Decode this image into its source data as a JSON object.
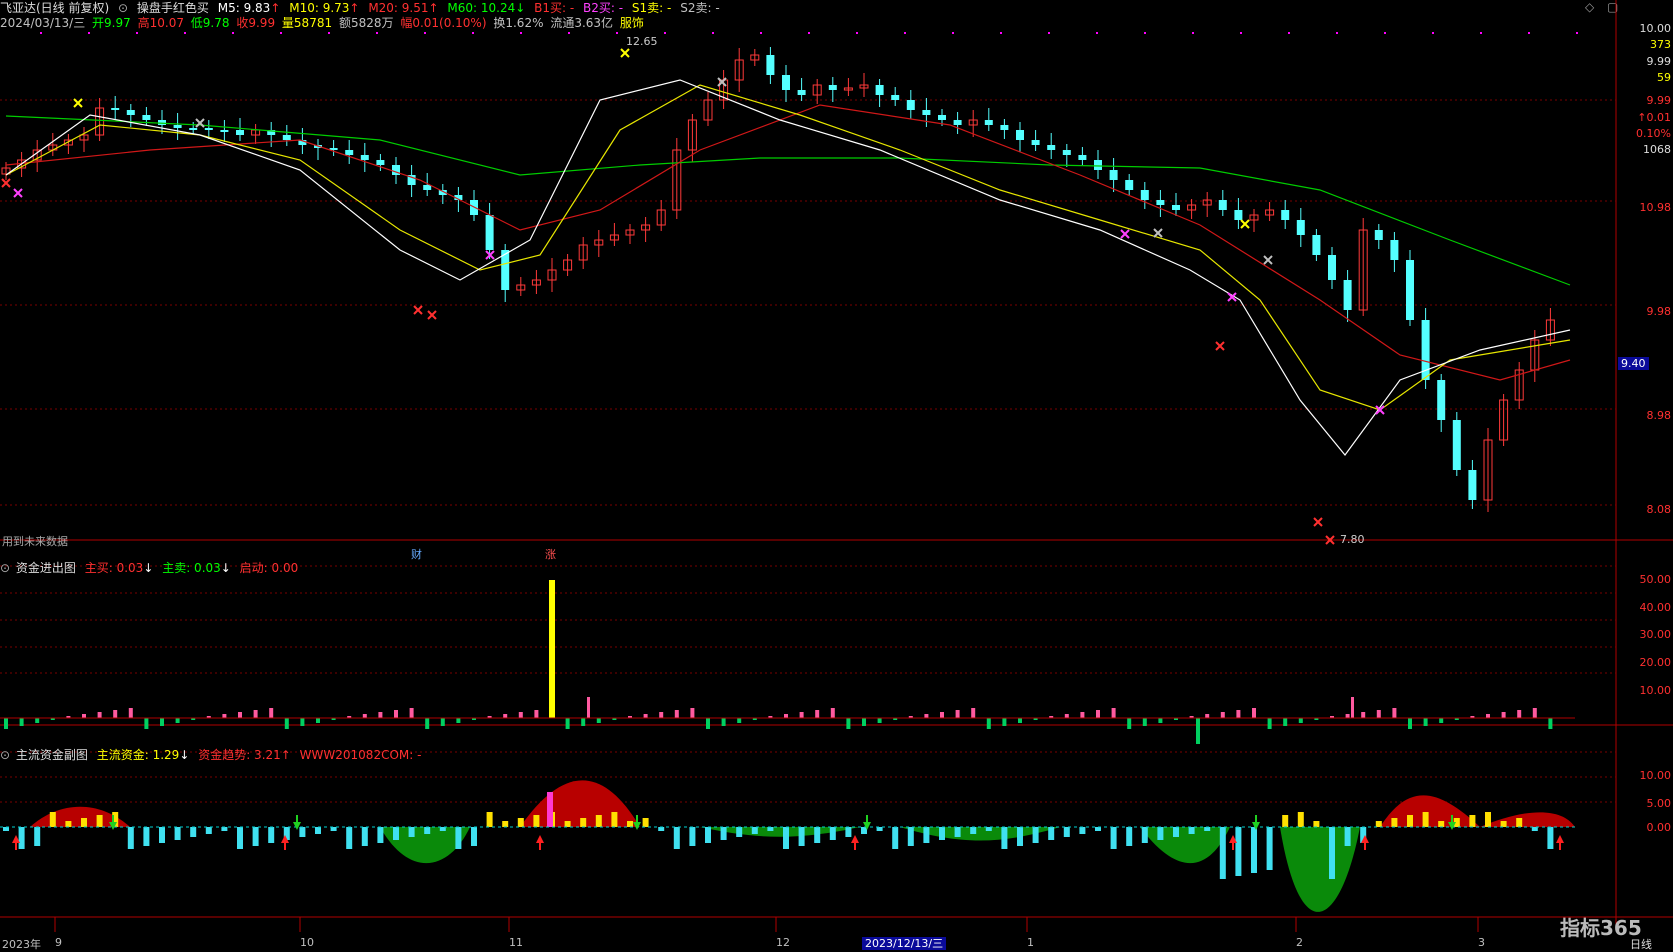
{
  "main": {
    "stock_name": "飞亚达(日线 前复权)",
    "indicator_title": "操盘手红色买",
    "ma": [
      {
        "label": "M5: 9.83",
        "color": "#ffffff"
      },
      {
        "label": "M10: 9.73",
        "color": "#ffff00"
      },
      {
        "label": "M20: 9.51",
        "color": "#ff3030"
      },
      {
        "label": "M60: 10.24",
        "color": "#00ff00"
      }
    ],
    "signals": [
      {
        "label": "B1买: -",
        "color": "#ff3030"
      },
      {
        "label": "B2买: -",
        "color": "#ff40ff"
      },
      {
        "label": "S1卖: -",
        "color": "#ffff00"
      },
      {
        "label": "S2卖: -",
        "color": "#c0c0c0"
      }
    ],
    "quote_date": "2024/03/13/三",
    "quote": [
      {
        "label": "开9.97",
        "color": "#00ff00"
      },
      {
        "label": "高10.07",
        "color": "#ff3030"
      },
      {
        "label": "低9.78",
        "color": "#00ff00"
      },
      {
        "label": "收9.99",
        "color": "#ff3030"
      },
      {
        "label": "量58781",
        "color": "#ffff00"
      },
      {
        "label": "额5828万",
        "color": "#c0c0c0"
      },
      {
        "label": "幅0.01(0.10%)",
        "color": "#ff3030"
      },
      {
        "label": "换1.62%",
        "color": "#c0c0c0"
      },
      {
        "label": "流通3.63亿",
        "color": "#c0c0c0"
      },
      {
        "label": "服饰",
        "color": "#ffff00"
      }
    ],
    "future_note": "用到未来数据",
    "event_cai": "财",
    "event_zhang": "涨",
    "high_label": "12.65",
    "low_label": "7.80",
    "price_axis": [
      "10.00",
      "373",
      "9.99",
      "59",
      "9.99",
      "↑0.01",
      "0.10%",
      "1068",
      "10.98",
      "9.98",
      "8.98",
      "8.08"
    ],
    "price_marker": "9.40"
  },
  "panel1": {
    "title": "资金进出图",
    "zhumai": "主买: 0.03",
    "zhumai2": "主卖: 0.03",
    "qidong": "启动: 0.00",
    "axis": [
      "50.00",
      "40.00",
      "30.00",
      "20.00",
      "10.00"
    ]
  },
  "panel2": {
    "title": "主流资金副图",
    "zhuliu": "主流资金: 1.29",
    "qushi": "资金趋势: 3.21",
    "site": "WWW201082COM: -",
    "axis": [
      "10.00",
      "5.00",
      "0.00"
    ]
  },
  "date_axis": [
    "2023年",
    "9",
    "10",
    "11",
    "12",
    "2023/12/13/三",
    "1",
    "2",
    "3"
  ],
  "brand": "指标365",
  "period": "日线",
  "chart_data": {
    "type": "candlestick",
    "series": [
      {
        "name": "M5",
        "color": "#ffffff"
      },
      {
        "name": "M10",
        "color": "#ffff00"
      },
      {
        "name": "M20",
        "color": "#ff3030"
      },
      {
        "name": "M60",
        "color": "#00cc00"
      }
    ],
    "ylim": [
      7.8,
      12.65
    ]
  }
}
